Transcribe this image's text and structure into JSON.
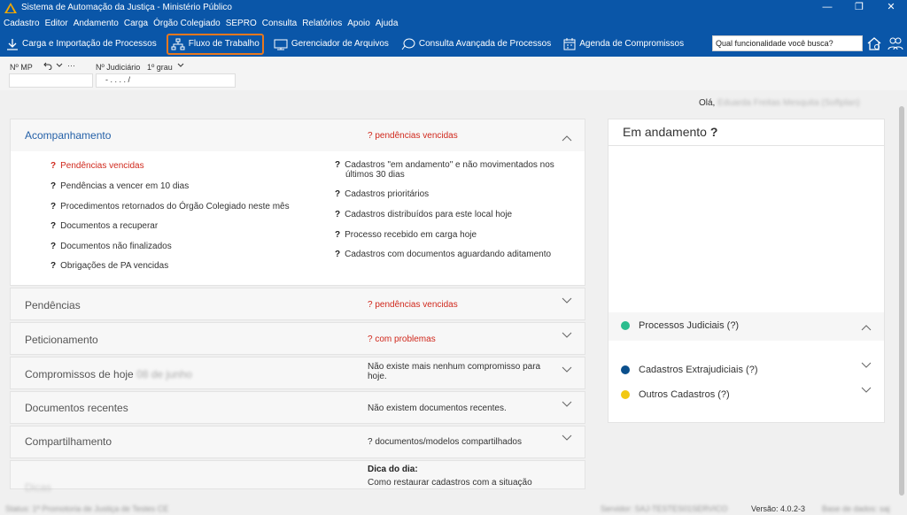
{
  "window": {
    "title": "Sistema de Automação da Justiça - Ministério Público",
    "controls": [
      "—",
      "❐",
      "✕"
    ]
  },
  "menu": [
    "Cadastro",
    "Editor",
    "Andamento",
    "Carga",
    "Órgão Colegiado",
    "SEPRO",
    "Consulta",
    "Relatórios",
    "Apoio",
    "Ajuda"
  ],
  "toolbar": {
    "carga": "Carga e Importação de Processos",
    "fluxo": "Fluxo de Trabalho",
    "gerenciador": "Gerenciador de Arquivos",
    "consulta": "Consulta Avançada de Processos",
    "agenda": "Agenda de Compromissos",
    "search_placeholder": "Qual funcionalidade você busca?"
  },
  "fields": {
    "mp_label": "Nº MP",
    "mp_value": "",
    "mp_more": "···",
    "judicial_label": "Nº Judiciário",
    "grau": "1º grau",
    "judicial_value": "- . . . . /"
  },
  "greeting": {
    "hello": "Olá,",
    "user": "Eduarda Freitas Mesquita (Softplan)"
  },
  "acompanhamento": {
    "title": "Acompanhamento",
    "status": "? pendências vencidas",
    "left_items": [
      {
        "text": "Pendências vencidas",
        "red": true
      },
      {
        "text": "Pendências a vencer em 10 dias",
        "red": false
      },
      {
        "text": "Procedimentos retornados do Órgão Colegiado neste mês",
        "red": false
      },
      {
        "text": "Documentos a recuperar",
        "red": false
      },
      {
        "text": "Documentos não finalizados",
        "red": false
      },
      {
        "text": "Obrigações de PA vencidas",
        "red": false
      }
    ],
    "right_items": [
      {
        "line1": "Cadastros \"em andamento\" e não movimentados nos",
        "line2": "últimos 30 dias"
      },
      {
        "line1": "Cadastros prioritários",
        "line2": ""
      },
      {
        "line1": "Cadastros distribuídos para este local hoje",
        "line2": ""
      },
      {
        "line1": "Processo recebido em carga hoje",
        "line2": ""
      },
      {
        "line1": "Cadastros com documentos aguardando aditamento",
        "line2": ""
      }
    ]
  },
  "panels": [
    {
      "title": "Pendências",
      "status1": "? pendências vencidas",
      "status2": "",
      "red": true
    },
    {
      "title": "Peticionamento",
      "status1": "? com problemas",
      "status2": "",
      "red": true
    },
    {
      "title": "Compromissos de hoje",
      "status1": "Não existe mais nenhum compromisso para",
      "status2": "hoje.",
      "red": false
    },
    {
      "title": "Documentos recentes",
      "status1": "Não existem documentos recentes.",
      "status2": "",
      "red": false
    },
    {
      "title": "Compartilhamento",
      "status1": "? documentos/modelos compartilhados",
      "status2": "",
      "red": false
    },
    {
      "title": "Dicas",
      "status1": "Dica do dia:",
      "status2": "Como restaurar cadastros com a situação",
      "red": false
    }
  ],
  "compromissos_date": "08 de junho",
  "em_andamento": {
    "title": "Em andamento",
    "q": "?",
    "legend": [
      {
        "label": "Processos Judiciais (?)",
        "color": "#2bbd8e"
      },
      {
        "label": "Cadastros Extrajudiciais (?)",
        "color": "#0b4f8c"
      },
      {
        "label": "Outros Cadastros (?)",
        "color": "#f2c811"
      }
    ]
  },
  "statusbar": {
    "left": "Status: 1ª Promotoria de Justiça de Testes CE",
    "servidor": "Servidor: SAJ-TESTES01SERVICO",
    "versao": "Versão: 4.0.2-3",
    "base": "Base de dados: saj"
  }
}
